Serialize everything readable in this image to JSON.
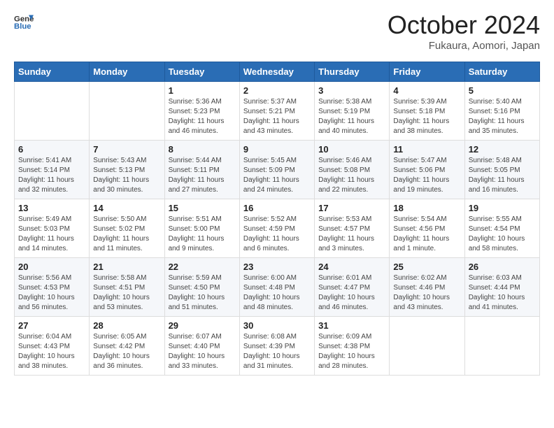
{
  "header": {
    "logo_line1": "General",
    "logo_line2": "Blue",
    "month": "October 2024",
    "location": "Fukaura, Aomori, Japan"
  },
  "weekdays": [
    "Sunday",
    "Monday",
    "Tuesday",
    "Wednesday",
    "Thursday",
    "Friday",
    "Saturday"
  ],
  "weeks": [
    [
      {
        "day": "",
        "sunrise": "",
        "sunset": "",
        "daylight": ""
      },
      {
        "day": "",
        "sunrise": "",
        "sunset": "",
        "daylight": ""
      },
      {
        "day": "1",
        "sunrise": "Sunrise: 5:36 AM",
        "sunset": "Sunset: 5:23 PM",
        "daylight": "Daylight: 11 hours and 46 minutes."
      },
      {
        "day": "2",
        "sunrise": "Sunrise: 5:37 AM",
        "sunset": "Sunset: 5:21 PM",
        "daylight": "Daylight: 11 hours and 43 minutes."
      },
      {
        "day": "3",
        "sunrise": "Sunrise: 5:38 AM",
        "sunset": "Sunset: 5:19 PM",
        "daylight": "Daylight: 11 hours and 40 minutes."
      },
      {
        "day": "4",
        "sunrise": "Sunrise: 5:39 AM",
        "sunset": "Sunset: 5:18 PM",
        "daylight": "Daylight: 11 hours and 38 minutes."
      },
      {
        "day": "5",
        "sunrise": "Sunrise: 5:40 AM",
        "sunset": "Sunset: 5:16 PM",
        "daylight": "Daylight: 11 hours and 35 minutes."
      }
    ],
    [
      {
        "day": "6",
        "sunrise": "Sunrise: 5:41 AM",
        "sunset": "Sunset: 5:14 PM",
        "daylight": "Daylight: 11 hours and 32 minutes."
      },
      {
        "day": "7",
        "sunrise": "Sunrise: 5:43 AM",
        "sunset": "Sunset: 5:13 PM",
        "daylight": "Daylight: 11 hours and 30 minutes."
      },
      {
        "day": "8",
        "sunrise": "Sunrise: 5:44 AM",
        "sunset": "Sunset: 5:11 PM",
        "daylight": "Daylight: 11 hours and 27 minutes."
      },
      {
        "day": "9",
        "sunrise": "Sunrise: 5:45 AM",
        "sunset": "Sunset: 5:09 PM",
        "daylight": "Daylight: 11 hours and 24 minutes."
      },
      {
        "day": "10",
        "sunrise": "Sunrise: 5:46 AM",
        "sunset": "Sunset: 5:08 PM",
        "daylight": "Daylight: 11 hours and 22 minutes."
      },
      {
        "day": "11",
        "sunrise": "Sunrise: 5:47 AM",
        "sunset": "Sunset: 5:06 PM",
        "daylight": "Daylight: 11 hours and 19 minutes."
      },
      {
        "day": "12",
        "sunrise": "Sunrise: 5:48 AM",
        "sunset": "Sunset: 5:05 PM",
        "daylight": "Daylight: 11 hours and 16 minutes."
      }
    ],
    [
      {
        "day": "13",
        "sunrise": "Sunrise: 5:49 AM",
        "sunset": "Sunset: 5:03 PM",
        "daylight": "Daylight: 11 hours and 14 minutes."
      },
      {
        "day": "14",
        "sunrise": "Sunrise: 5:50 AM",
        "sunset": "Sunset: 5:02 PM",
        "daylight": "Daylight: 11 hours and 11 minutes."
      },
      {
        "day": "15",
        "sunrise": "Sunrise: 5:51 AM",
        "sunset": "Sunset: 5:00 PM",
        "daylight": "Daylight: 11 hours and 9 minutes."
      },
      {
        "day": "16",
        "sunrise": "Sunrise: 5:52 AM",
        "sunset": "Sunset: 4:59 PM",
        "daylight": "Daylight: 11 hours and 6 minutes."
      },
      {
        "day": "17",
        "sunrise": "Sunrise: 5:53 AM",
        "sunset": "Sunset: 4:57 PM",
        "daylight": "Daylight: 11 hours and 3 minutes."
      },
      {
        "day": "18",
        "sunrise": "Sunrise: 5:54 AM",
        "sunset": "Sunset: 4:56 PM",
        "daylight": "Daylight: 11 hours and 1 minute."
      },
      {
        "day": "19",
        "sunrise": "Sunrise: 5:55 AM",
        "sunset": "Sunset: 4:54 PM",
        "daylight": "Daylight: 10 hours and 58 minutes."
      }
    ],
    [
      {
        "day": "20",
        "sunrise": "Sunrise: 5:56 AM",
        "sunset": "Sunset: 4:53 PM",
        "daylight": "Daylight: 10 hours and 56 minutes."
      },
      {
        "day": "21",
        "sunrise": "Sunrise: 5:58 AM",
        "sunset": "Sunset: 4:51 PM",
        "daylight": "Daylight: 10 hours and 53 minutes."
      },
      {
        "day": "22",
        "sunrise": "Sunrise: 5:59 AM",
        "sunset": "Sunset: 4:50 PM",
        "daylight": "Daylight: 10 hours and 51 minutes."
      },
      {
        "day": "23",
        "sunrise": "Sunrise: 6:00 AM",
        "sunset": "Sunset: 4:48 PM",
        "daylight": "Daylight: 10 hours and 48 minutes."
      },
      {
        "day": "24",
        "sunrise": "Sunrise: 6:01 AM",
        "sunset": "Sunset: 4:47 PM",
        "daylight": "Daylight: 10 hours and 46 minutes."
      },
      {
        "day": "25",
        "sunrise": "Sunrise: 6:02 AM",
        "sunset": "Sunset: 4:46 PM",
        "daylight": "Daylight: 10 hours and 43 minutes."
      },
      {
        "day": "26",
        "sunrise": "Sunrise: 6:03 AM",
        "sunset": "Sunset: 4:44 PM",
        "daylight": "Daylight: 10 hours and 41 minutes."
      }
    ],
    [
      {
        "day": "27",
        "sunrise": "Sunrise: 6:04 AM",
        "sunset": "Sunset: 4:43 PM",
        "daylight": "Daylight: 10 hours and 38 minutes."
      },
      {
        "day": "28",
        "sunrise": "Sunrise: 6:05 AM",
        "sunset": "Sunset: 4:42 PM",
        "daylight": "Daylight: 10 hours and 36 minutes."
      },
      {
        "day": "29",
        "sunrise": "Sunrise: 6:07 AM",
        "sunset": "Sunset: 4:40 PM",
        "daylight": "Daylight: 10 hours and 33 minutes."
      },
      {
        "day": "30",
        "sunrise": "Sunrise: 6:08 AM",
        "sunset": "Sunset: 4:39 PM",
        "daylight": "Daylight: 10 hours and 31 minutes."
      },
      {
        "day": "31",
        "sunrise": "Sunrise: 6:09 AM",
        "sunset": "Sunset: 4:38 PM",
        "daylight": "Daylight: 10 hours and 28 minutes."
      },
      {
        "day": "",
        "sunrise": "",
        "sunset": "",
        "daylight": ""
      },
      {
        "day": "",
        "sunrise": "",
        "sunset": "",
        "daylight": ""
      }
    ]
  ]
}
